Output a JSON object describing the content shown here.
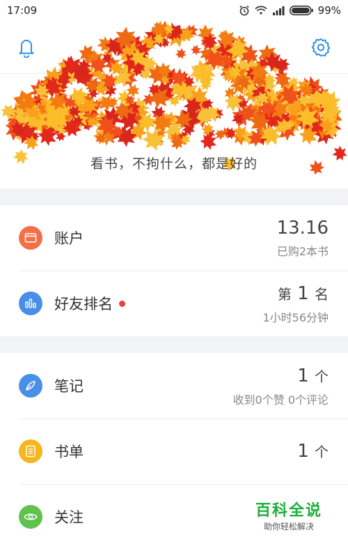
{
  "status": {
    "time": "17:09",
    "battery": "99%"
  },
  "header": {
    "slogan": "看书，不拘什么，都是好的"
  },
  "card1": [
    {
      "label": "账户",
      "main": "13.16",
      "sub": "已购2本书",
      "color": "#f36f47",
      "icon": "wallet-icon"
    },
    {
      "label": "好友排名",
      "main_prefix": "第",
      "main_num": "1",
      "main_suffix": "名",
      "sub": "1小时56分钟",
      "color": "#4a8fe7",
      "icon": "bar-chart-icon",
      "badge": true
    }
  ],
  "card2": [
    {
      "label": "笔记",
      "main_num": "1",
      "main_suffix": "个",
      "sub": "收到0个赞 0个评论",
      "color": "#4a8fe7",
      "icon": "feather-pen-icon"
    },
    {
      "label": "书单",
      "main_num": "1",
      "main_suffix": "个",
      "color": "#f6b61c",
      "icon": "list-document-icon"
    },
    {
      "label": "关注",
      "color": "#5fc24b",
      "icon": "eye-icon"
    }
  ],
  "watermark": {
    "title": "百科全说",
    "subtitle": "助你轻松解决"
  },
  "colors": {
    "accent": "#2f8ee6",
    "badge": "#f23c3c"
  }
}
